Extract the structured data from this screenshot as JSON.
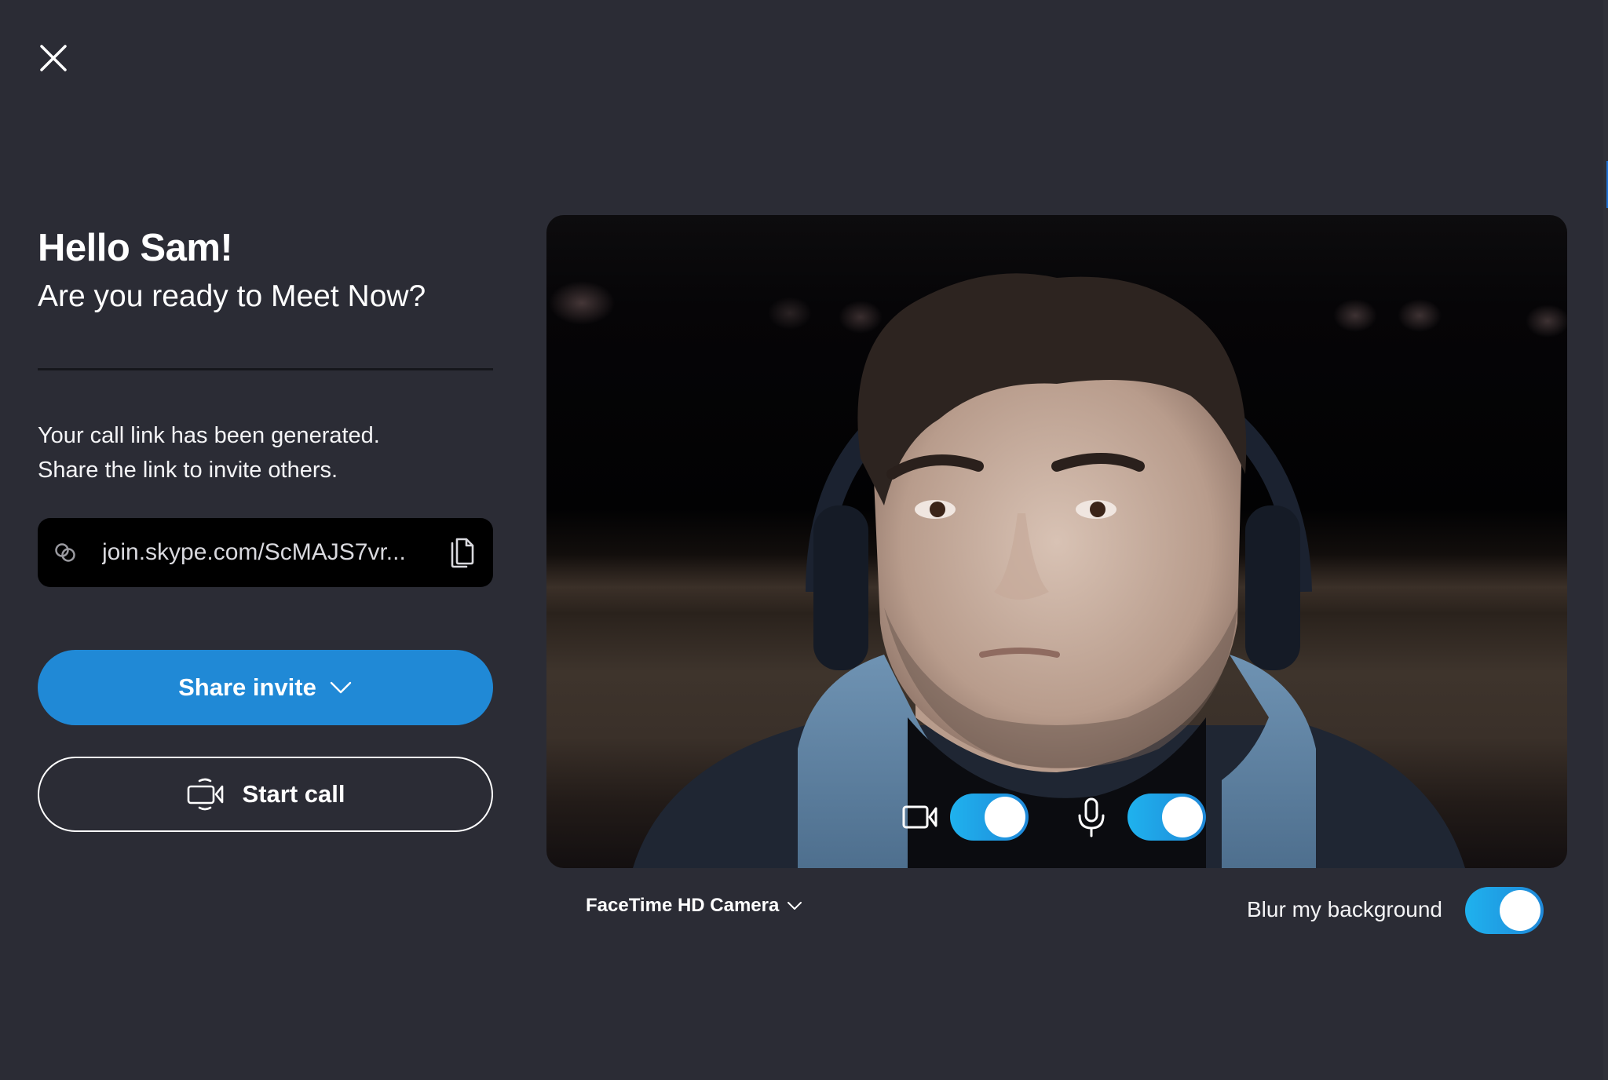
{
  "header": {
    "close_icon": "close-icon"
  },
  "welcome": {
    "greeting": "Hello Sam!",
    "subtitle": "Are you ready to Meet Now?"
  },
  "call_link": {
    "info_line1": "Your call link has been generated.",
    "info_line2": "Share the link to invite others.",
    "link_icon": "link-icon",
    "url": "join.skype.com/ScMAJS7vr...",
    "copy_icon": "copy-icon"
  },
  "actions": {
    "share_invite_label": "Share invite",
    "start_call_label": "Start call"
  },
  "preview": {
    "video_toggle": {
      "icon": "video-camera-icon",
      "on": true
    },
    "mic_toggle": {
      "icon": "microphone-icon",
      "on": true
    },
    "camera_device": "FaceTime HD Camera",
    "blur_label": "Blur my background",
    "blur_on": true
  },
  "colors": {
    "background": "#2b2c35",
    "accent": "#2089d6",
    "toggle_gradient_start": "#1fb2ee",
    "toggle_gradient_end": "#1f88d8",
    "link_box": "#000000"
  }
}
